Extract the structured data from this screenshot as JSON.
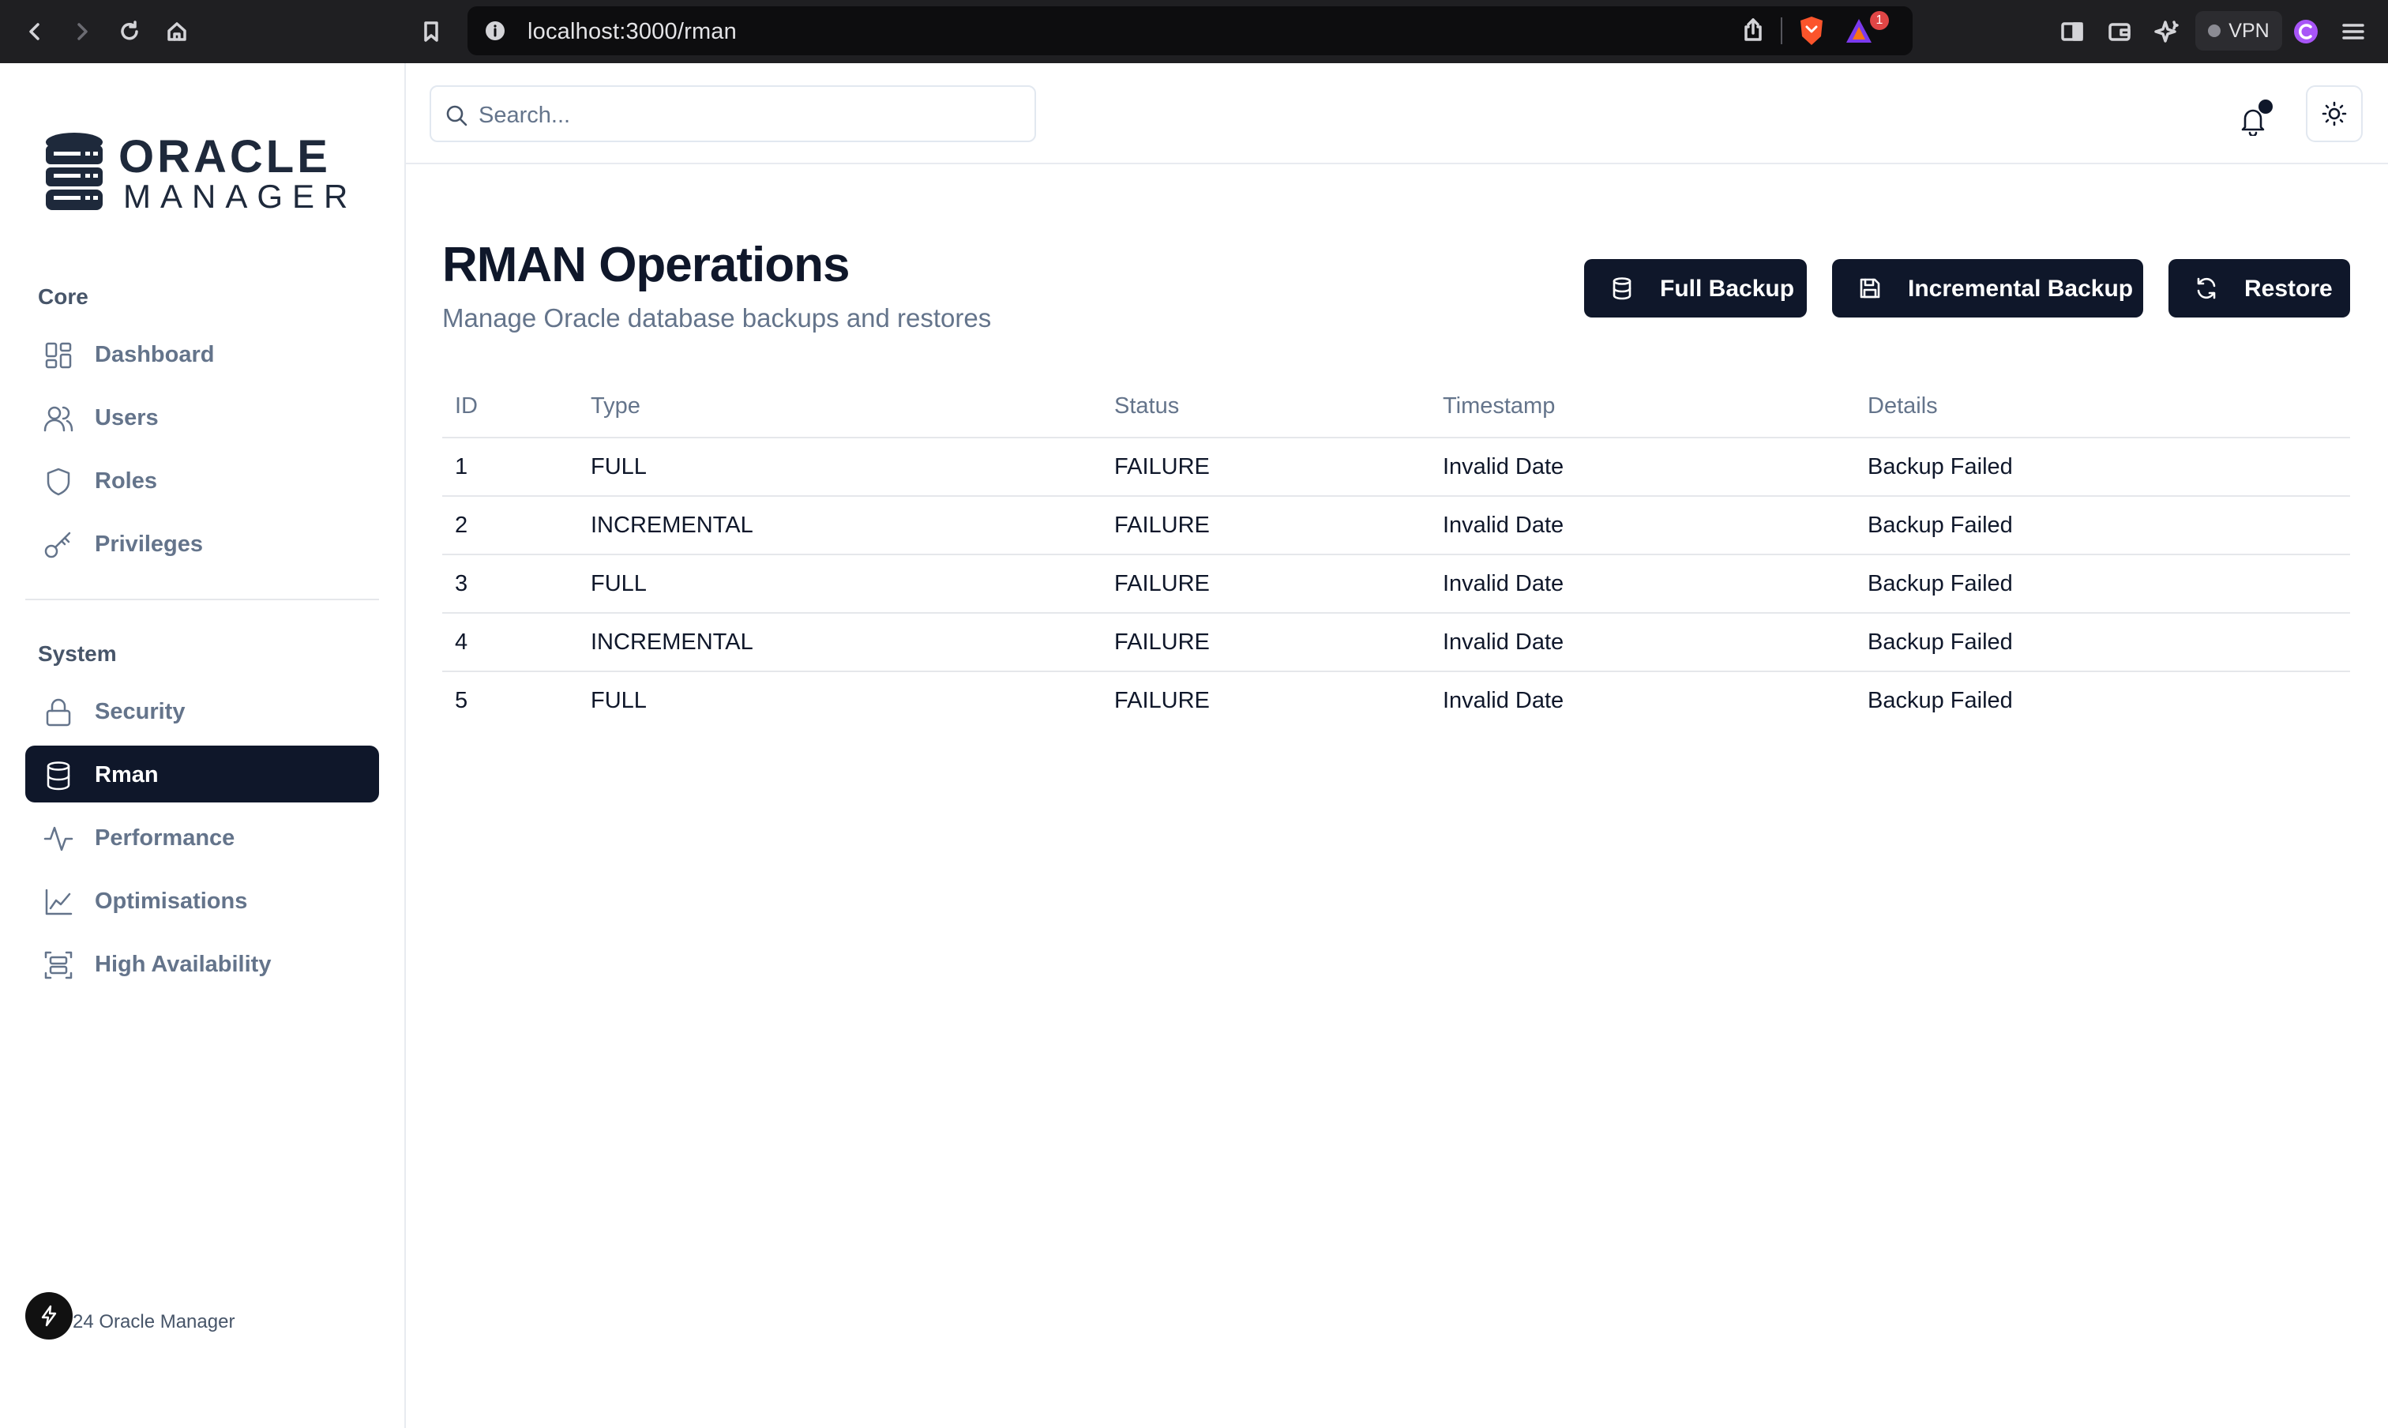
{
  "browser": {
    "url": "localhost:3000/rman",
    "vpn_label": "VPN",
    "alert_count": "1"
  },
  "sidebar": {
    "logo_top": "ORACLE",
    "logo_bottom": "MANAGER",
    "core_label": "Core",
    "system_label": "System",
    "core_items": [
      {
        "label": "Dashboard",
        "icon": "dashboard-icon"
      },
      {
        "label": "Users",
        "icon": "users-icon"
      },
      {
        "label": "Roles",
        "icon": "shield-icon"
      },
      {
        "label": "Privileges",
        "icon": "key-icon"
      }
    ],
    "system_items": [
      {
        "label": "Security",
        "icon": "lock-icon"
      },
      {
        "label": "Rman",
        "icon": "database-icon",
        "active": true
      },
      {
        "label": "Performance",
        "icon": "activity-icon"
      },
      {
        "label": "Optimisations",
        "icon": "line-chart-icon"
      },
      {
        "label": "High Availability",
        "icon": "server-icon"
      }
    ],
    "footer": "24 Oracle Manager"
  },
  "topbar": {
    "search_placeholder": "Search..."
  },
  "main": {
    "title": "RMAN Operations",
    "subtitle": "Manage Oracle database backups and restores",
    "actions": {
      "full_backup": "Full Backup",
      "incremental_backup": "Incremental Backup",
      "restore": "Restore"
    },
    "table": {
      "headers": [
        "ID",
        "Type",
        "Status",
        "Timestamp",
        "Details"
      ],
      "rows": [
        [
          "1",
          "FULL",
          "FAILURE",
          "Invalid Date",
          "Backup Failed"
        ],
        [
          "2",
          "INCREMENTAL",
          "FAILURE",
          "Invalid Date",
          "Backup Failed"
        ],
        [
          "3",
          "FULL",
          "FAILURE",
          "Invalid Date",
          "Backup Failed"
        ],
        [
          "4",
          "INCREMENTAL",
          "FAILURE",
          "Invalid Date",
          "Backup Failed"
        ],
        [
          "5",
          "FULL",
          "FAILURE",
          "Invalid Date",
          "Backup Failed"
        ]
      ]
    }
  },
  "colors": {
    "primary": "#0f172a",
    "muted": "#64748b",
    "border": "#e5e7eb"
  }
}
